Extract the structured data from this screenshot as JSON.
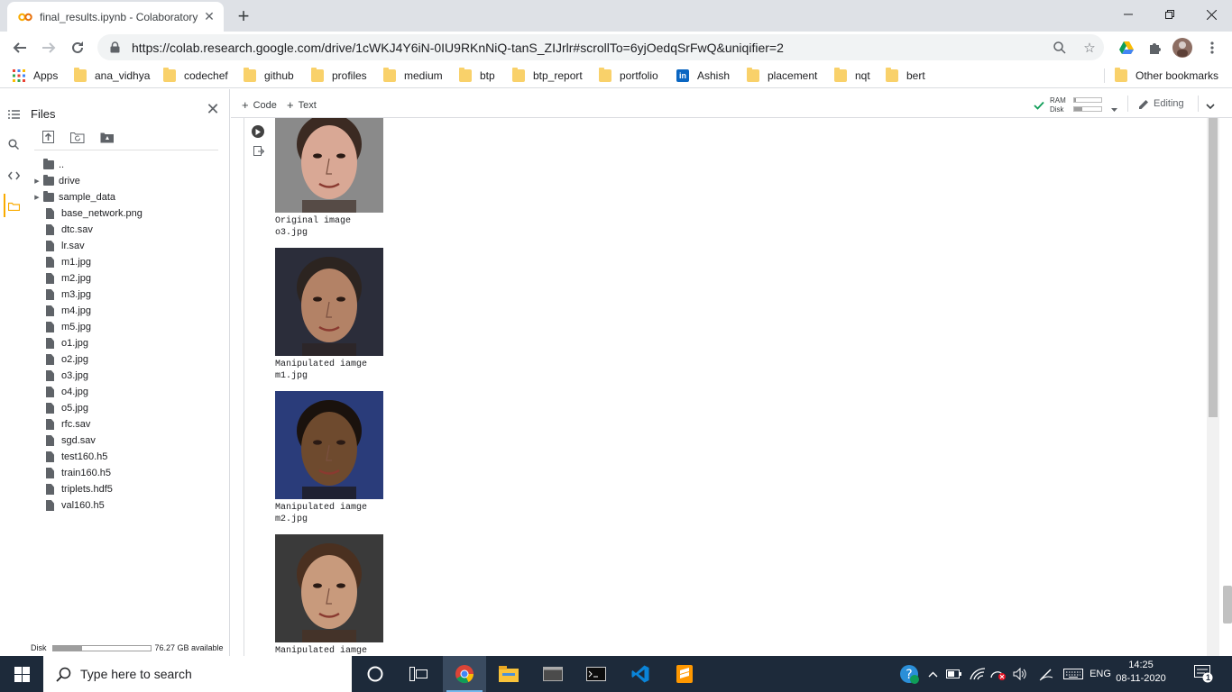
{
  "browser": {
    "tab": {
      "title": "final_results.ipynb - Colaboratory"
    },
    "url": "https://colab.research.google.com/drive/1cWKJ4Y6iN-0IU9RKnNiQ-tanS_ZIJrlr#scrollTo=6yjOedqSrFwQ&uniqifier=2",
    "bookmarks": [
      {
        "label": "Apps",
        "icon": "apps-grid-icon"
      },
      {
        "label": "ana_vidhya",
        "icon": "folder-icon"
      },
      {
        "label": "codechef",
        "icon": "folder-icon"
      },
      {
        "label": "github",
        "icon": "folder-icon"
      },
      {
        "label": "profiles",
        "icon": "folder-icon"
      },
      {
        "label": "medium",
        "icon": "folder-icon"
      },
      {
        "label": "btp",
        "icon": "folder-icon"
      },
      {
        "label": "btp_report",
        "icon": "folder-icon"
      },
      {
        "label": "portfolio",
        "icon": "folder-icon"
      },
      {
        "label": "Ashish",
        "icon": "linkedin-icon"
      },
      {
        "label": "placement",
        "icon": "folder-icon"
      },
      {
        "label": "nqt",
        "icon": "folder-icon"
      },
      {
        "label": "bert",
        "icon": "folder-icon"
      }
    ],
    "other_bookmarks": "Other bookmarks"
  },
  "files_panel": {
    "title": "Files",
    "items": [
      {
        "name": "..",
        "type": "parent"
      },
      {
        "name": "drive",
        "type": "folder"
      },
      {
        "name": "sample_data",
        "type": "folder"
      },
      {
        "name": "base_network.png",
        "type": "file"
      },
      {
        "name": "dtc.sav",
        "type": "file"
      },
      {
        "name": "lr.sav",
        "type": "file"
      },
      {
        "name": "m1.jpg",
        "type": "file"
      },
      {
        "name": "m2.jpg",
        "type": "file"
      },
      {
        "name": "m3.jpg",
        "type": "file"
      },
      {
        "name": "m4.jpg",
        "type": "file"
      },
      {
        "name": "m5.jpg",
        "type": "file"
      },
      {
        "name": "o1.jpg",
        "type": "file"
      },
      {
        "name": "o2.jpg",
        "type": "file"
      },
      {
        "name": "o3.jpg",
        "type": "file"
      },
      {
        "name": "o4.jpg",
        "type": "file"
      },
      {
        "name": "o5.jpg",
        "type": "file"
      },
      {
        "name": "rfc.sav",
        "type": "file"
      },
      {
        "name": "sgd.sav",
        "type": "file"
      },
      {
        "name": "test160.h5",
        "type": "file"
      },
      {
        "name": "train160.h5",
        "type": "file"
      },
      {
        "name": "triplets.hdf5",
        "type": "file"
      },
      {
        "name": "val160.h5",
        "type": "file"
      }
    ],
    "disk": {
      "label": "Disk",
      "available": "76.27 GB available",
      "used_fraction": 0.3
    }
  },
  "notebook_toolbar": {
    "code_label": "Code",
    "text_label": "Text",
    "ram_label": "RAM",
    "disk_label": "Disk",
    "ram_fraction": 0.05,
    "disk_fraction": 0.3,
    "editing_label": "Editing"
  },
  "outputs": [
    {
      "caption": "Original image",
      "filename": "o3.jpg",
      "palette": {
        "bg": "#8a8a8a",
        "skin": "#d9a895",
        "hair": "#3b2a22"
      }
    },
    {
      "caption": "Manipulated iamge",
      "filename": "m1.jpg",
      "palette": {
        "bg": "#2b2d3a",
        "skin": "#b38266",
        "hair": "#2c2420"
      }
    },
    {
      "caption": "Manipulated iamge",
      "filename": "m2.jpg",
      "palette": {
        "bg": "#2a3c7a",
        "skin": "#6e4a2e",
        "hair": "#1a120d"
      }
    },
    {
      "caption": "Manipulated iamge",
      "filename": "",
      "palette": {
        "bg": "#3a3a3a",
        "skin": "#c89a7c",
        "hair": "#4a3020"
      }
    }
  ],
  "taskbar": {
    "search_placeholder": "Type here to search",
    "language": "ENG",
    "time": "14:25",
    "date": "08-11-2020",
    "notification_count": "1"
  },
  "colors": {
    "tab_strip": "#dee1e6",
    "taskbar": "#1d2a3a",
    "colab_orange": "#f9ab00",
    "folder_yellow": "#f9d16a"
  }
}
